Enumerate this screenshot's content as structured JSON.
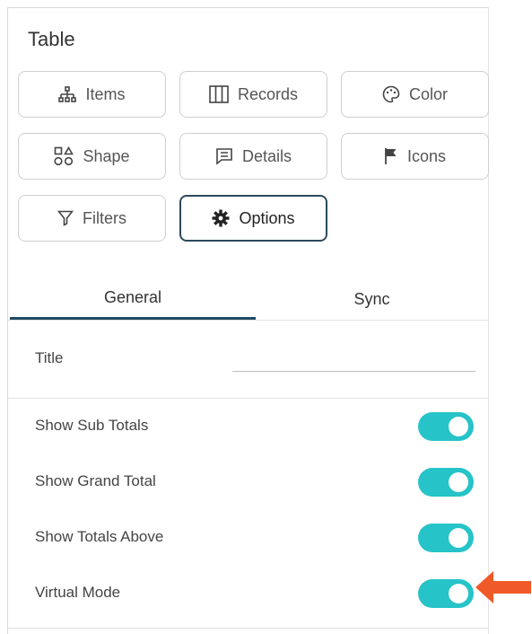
{
  "panel": {
    "title": "Table"
  },
  "buttons": {
    "items": "Items",
    "records": "Records",
    "color": "Color",
    "shape": "Shape",
    "details": "Details",
    "icons": "Icons",
    "filters": "Filters",
    "options": "Options"
  },
  "tabs": {
    "general": "General",
    "sync": "Sync"
  },
  "title_field": {
    "label": "Title",
    "value": ""
  },
  "toggles": [
    {
      "label": "Show Sub Totals",
      "on": true
    },
    {
      "label": "Show Grand Total",
      "on": true
    },
    {
      "label": "Show Totals Above",
      "on": true
    },
    {
      "label": "Virtual Mode",
      "on": true
    }
  ],
  "colors": {
    "toggle_on": "#26c3c8",
    "active_tab": "#1f4b63",
    "arrow": "#f05a28"
  }
}
